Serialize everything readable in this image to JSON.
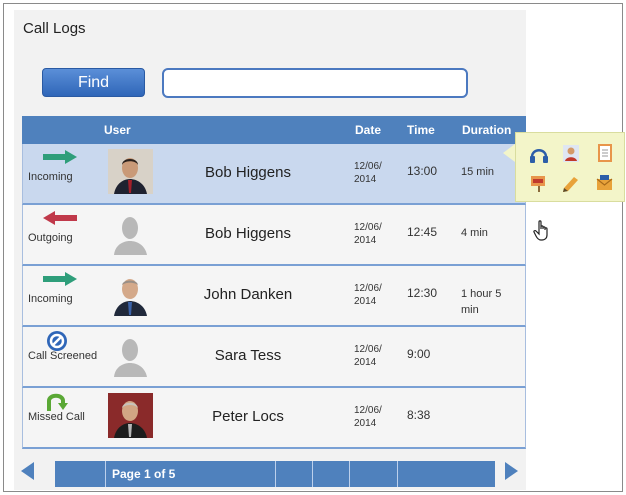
{
  "title": "Call Logs",
  "find_label": "Find",
  "search_value": "",
  "columns": {
    "user": "User",
    "date": "Date",
    "time": "Time",
    "duration": "Duration"
  },
  "rows": [
    {
      "type": "Incoming",
      "name": "Bob Higgens",
      "date": "12/06/ 2014",
      "time": "13:00",
      "duration": "15 min",
      "icon": "incoming-arrow-icon",
      "avatar": "photo"
    },
    {
      "type": "Outgoing",
      "name": "Bob Higgens",
      "date": "12/06/ 2014",
      "time": "12:45",
      "duration": "4 min",
      "icon": "outgoing-arrow-icon",
      "avatar": "placeholder"
    },
    {
      "type": "Incoming",
      "name": "John Danken",
      "date": "12/06/ 2014",
      "time": "12:30",
      "duration": "1 hour 5 min",
      "icon": "incoming-arrow-icon",
      "avatar": "photo"
    },
    {
      "type": "Call Screened",
      "name": "Sara Tess",
      "date": "12/06/ 2014",
      "time": "9:00",
      "duration": "",
      "icon": "call-screened-icon",
      "avatar": "placeholder"
    },
    {
      "type": "Missed Call",
      "name": "Peter Locs",
      "date": "12/06/ 2014",
      "time": "8:38",
      "duration": "",
      "icon": "missed-call-icon",
      "avatar": "photo"
    }
  ],
  "pager": {
    "label": "Page 1 of 5"
  },
  "popup_icons": [
    "headset-icon",
    "contact-icon",
    "notes-icon",
    "flag-icon",
    "edit-icon",
    "mail-icon"
  ],
  "colors": {
    "accent": "#4f81bd",
    "selected_row": "#c9d8ee",
    "popup": "#f3f5c9",
    "incoming": "#2e9e7a",
    "outgoing": "#c0394a"
  }
}
